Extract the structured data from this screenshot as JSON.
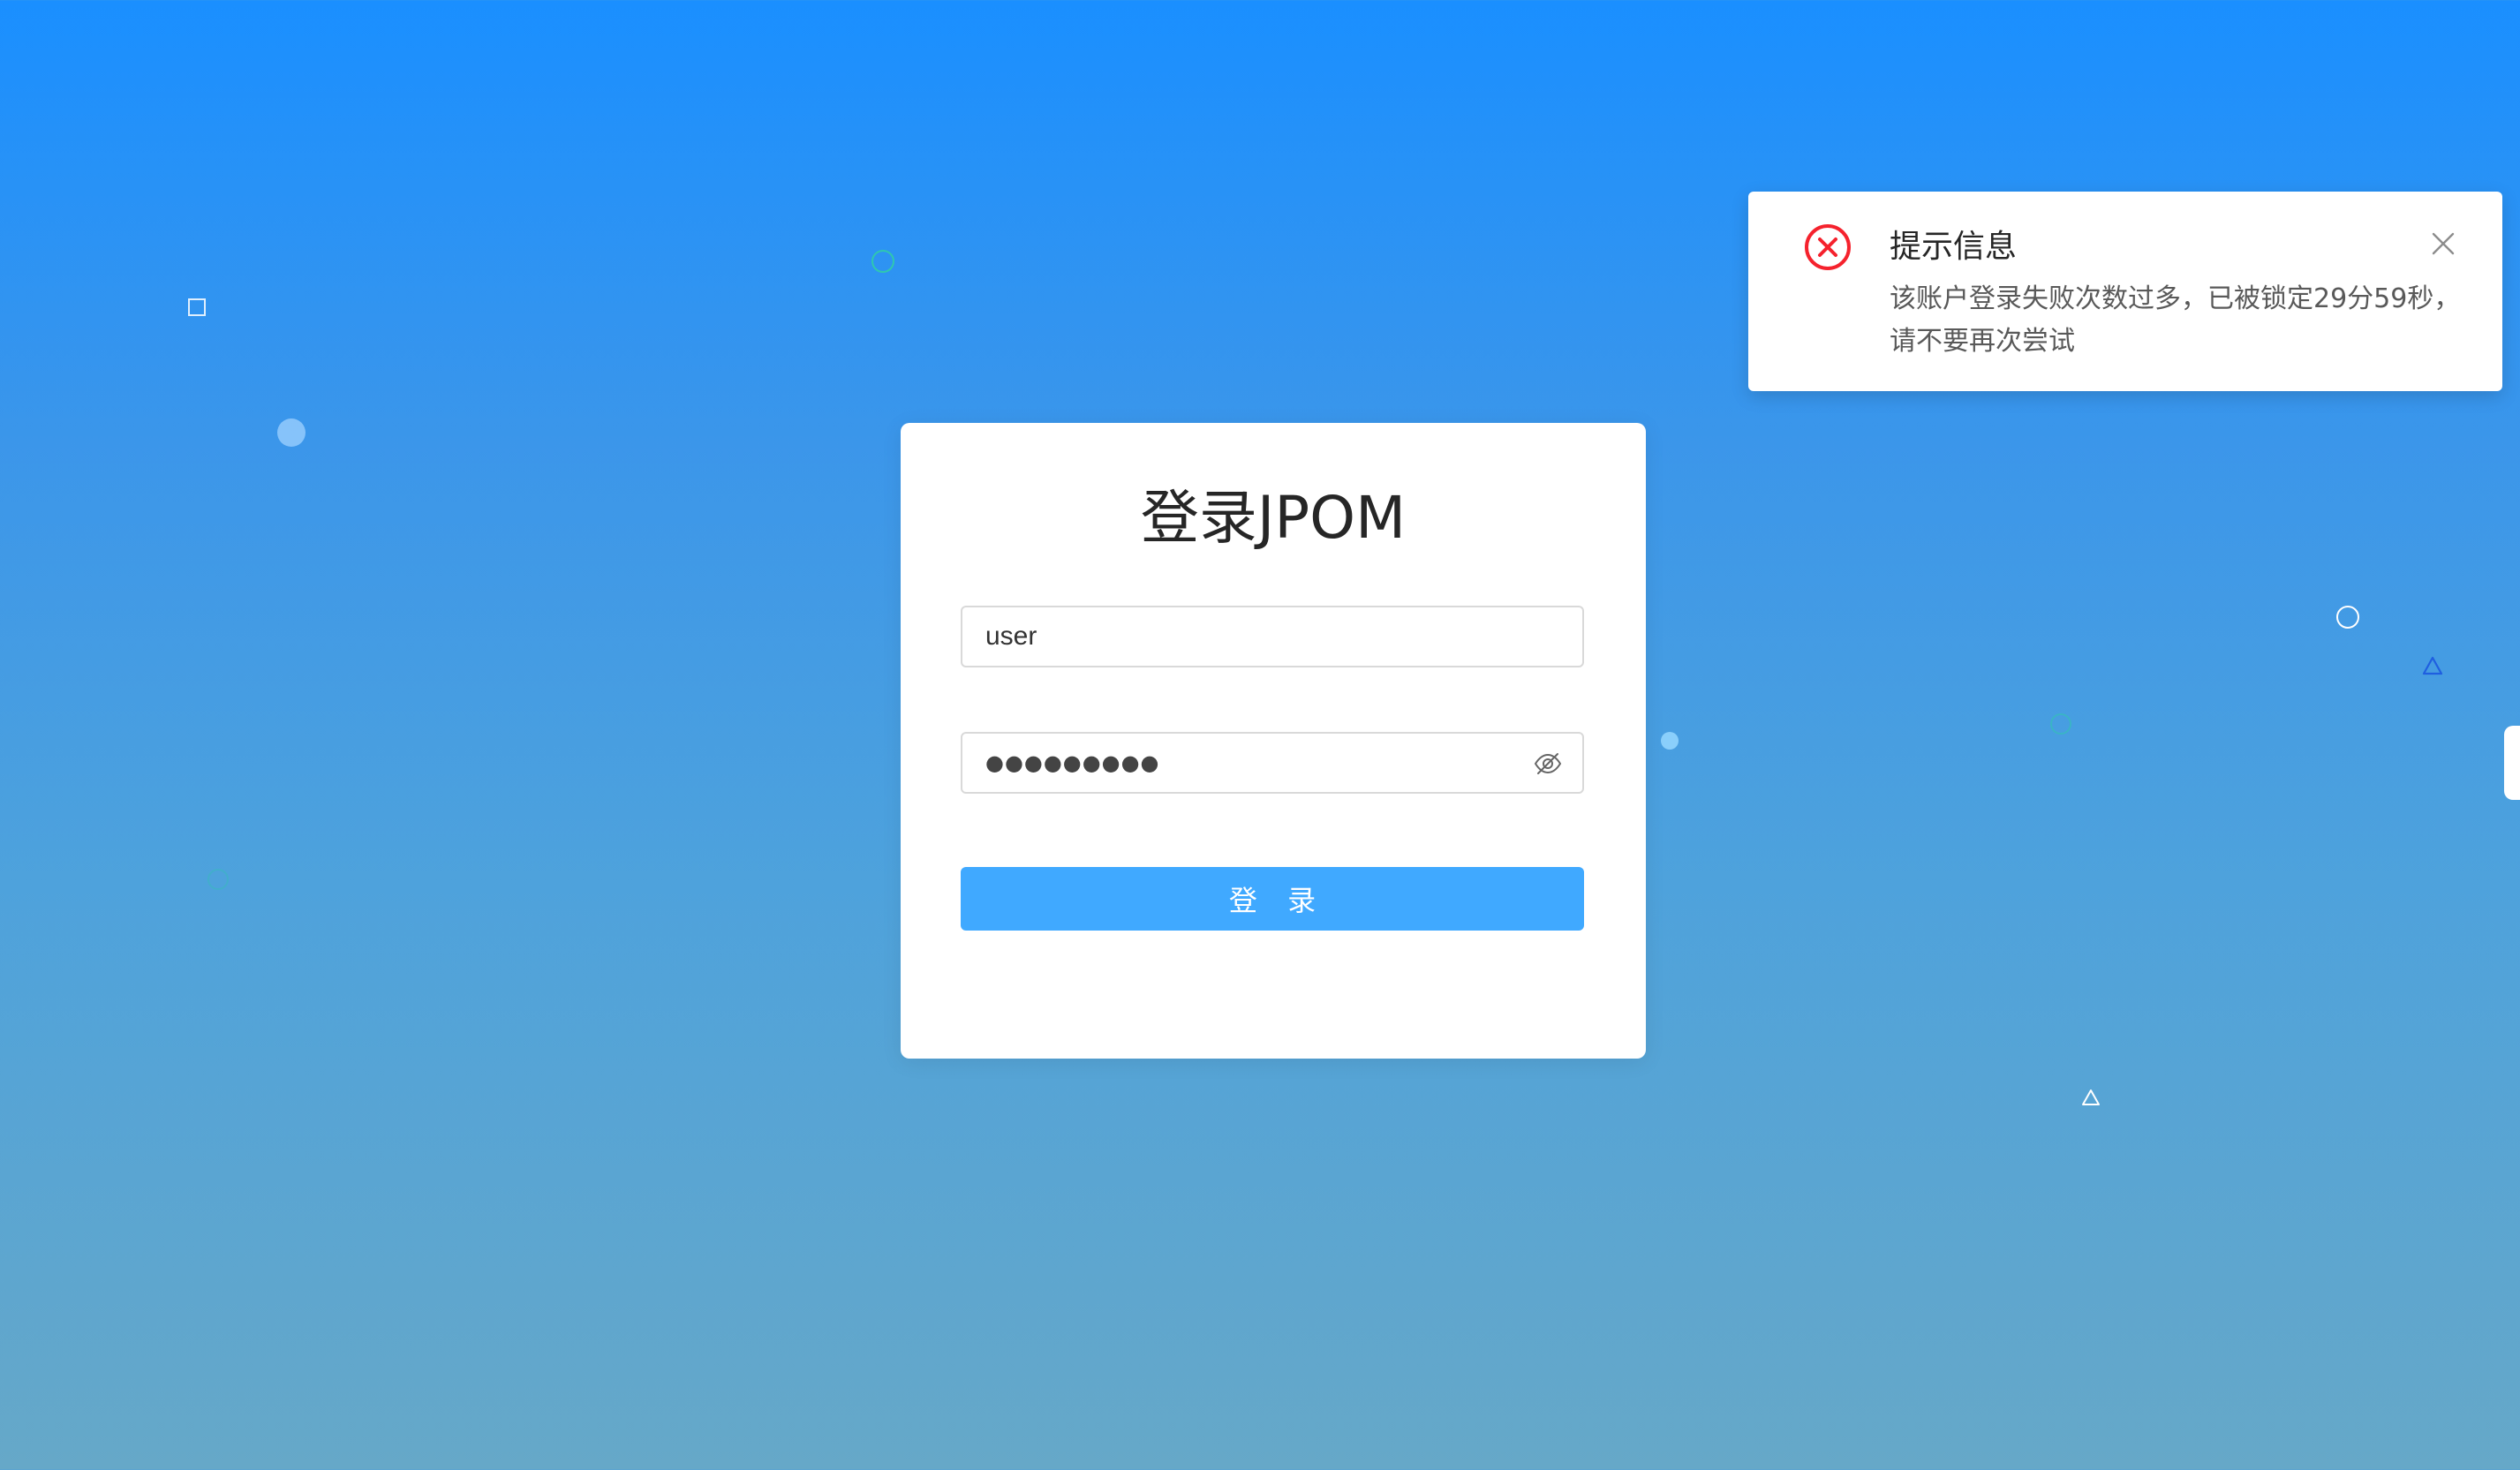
{
  "login": {
    "title": "登录JPOM",
    "username_value": "user",
    "password_mask": "●●●●●●●●●",
    "submit_label": "登 录"
  },
  "notification": {
    "title": "提示信息",
    "message": "该账户登录失败次数过多，已被锁定29分59秒，请不要再次尝试",
    "icon": "close-circle-icon",
    "close_icon": "close-icon"
  },
  "colors": {
    "primary_button": "#40a9ff",
    "error": "#f5222d",
    "background_top": "#1a8fff",
    "background_bottom": "#66a8c8"
  }
}
